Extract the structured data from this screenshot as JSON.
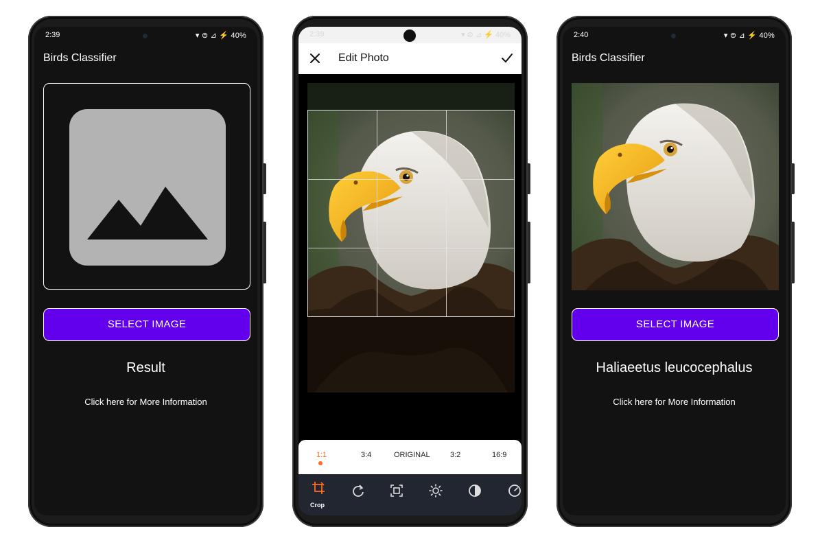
{
  "left_phone": {
    "status": {
      "time": "2:39",
      "indicators": "▾ ⊜ ⊿ ⚡ 40%"
    },
    "app_title": "Birds Classifier",
    "image_icon": "image-placeholder-icon",
    "select_button_label": "SELECT IMAGE",
    "result_text": "Result",
    "more_info_link": "Click here for More Information"
  },
  "middle_phone": {
    "status": {
      "time": "2:39",
      "indicators": "▾ ⊜ ⊿ ⚡ 40%"
    },
    "header": {
      "close_icon": "close-icon",
      "title": "Edit Photo",
      "confirm_icon": "check-icon"
    },
    "aspect_ratios": [
      {
        "label": "1:1",
        "active": true
      },
      {
        "label": "3:4",
        "active": false
      },
      {
        "label": "ORIGINAL",
        "active": false
      },
      {
        "label": "3:2",
        "active": false
      },
      {
        "label": "16:9",
        "active": false
      }
    ],
    "tools": [
      {
        "icon": "crop-icon",
        "label": "Crop",
        "active": true
      },
      {
        "icon": "rotate-icon"
      },
      {
        "icon": "expand-icon"
      },
      {
        "icon": "brightness-icon"
      },
      {
        "icon": "contrast-icon"
      },
      {
        "icon": "gauge-icon"
      }
    ],
    "accent_color": "#ff6d1f"
  },
  "right_phone": {
    "status": {
      "time": "2:40",
      "indicators": "▾ ⊜ ⊿ ⚡ 40%"
    },
    "app_title": "Birds Classifier",
    "select_button_label": "SELECT IMAGE",
    "result_text": "Haliaeetus leucocephalus",
    "more_info_link": "Click here for More Information"
  },
  "colors": {
    "button": "#6200ee",
    "screen_bg": "#121212"
  }
}
